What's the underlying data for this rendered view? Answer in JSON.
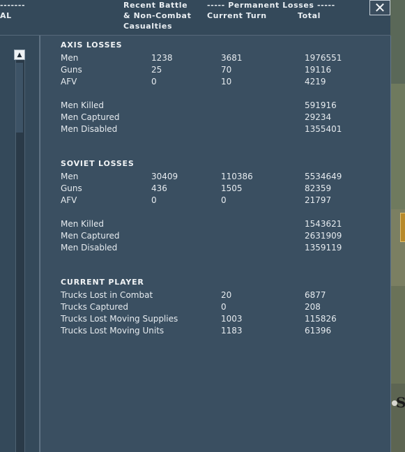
{
  "header": {
    "left_dashes": "-------",
    "left_tail": "AL",
    "recent_line1": "Recent Battle",
    "recent_line2": "& Non-Combat",
    "recent_line3": "Casualties",
    "perm_banner": "----- Permanent Losses -----",
    "current_turn": "Current Turn",
    "total": "Total",
    "close_glyph": "✕"
  },
  "scrollbar": {
    "up_glyph": "▲"
  },
  "axis": {
    "title": "AXIS LOSSES",
    "rows": [
      {
        "label": "Men",
        "recent": "1238",
        "current": "3681",
        "total": "1976551"
      },
      {
        "label": "Guns",
        "recent": "25",
        "current": "70",
        "total": "19116"
      },
      {
        "label": "AFV",
        "recent": "0",
        "current": "10",
        "total": "4219"
      }
    ],
    "detail": [
      {
        "label": "Men Killed",
        "total": "591916"
      },
      {
        "label": "Men Captured",
        "total": "29234"
      },
      {
        "label": "Men Disabled",
        "total": "1355401"
      }
    ]
  },
  "soviet": {
    "title": "SOVIET LOSSES",
    "rows": [
      {
        "label": "Men",
        "recent": "30409",
        "current": "110386",
        "total": "5534649"
      },
      {
        "label": "Guns",
        "recent": "436",
        "current": "1505",
        "total": "82359"
      },
      {
        "label": "AFV",
        "recent": "0",
        "current": "0",
        "total": "21797"
      }
    ],
    "detail": [
      {
        "label": "Men Killed",
        "total": "1543621"
      },
      {
        "label": "Men Captured",
        "total": "2631909"
      },
      {
        "label": "Men Disabled",
        "total": "1359119"
      }
    ]
  },
  "player": {
    "title": "CURRENT PLAYER",
    "rows": [
      {
        "label": "Trucks Lost in Combat",
        "current": "20",
        "total": "6877"
      },
      {
        "label": "Trucks Captured",
        "current": "0",
        "total": "208"
      },
      {
        "label": "Trucks Lost Moving Supplies",
        "current": "1003",
        "total": "115826"
      },
      {
        "label": "Trucks Lost Moving Units",
        "current": "1183",
        "total": "61396"
      }
    ]
  },
  "map": {
    "edge_letter": "S"
  }
}
